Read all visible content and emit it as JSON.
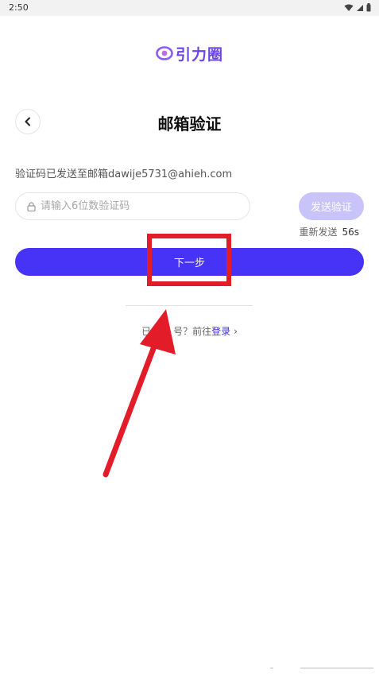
{
  "status_bar": {
    "time": "2:50",
    "icons": [
      "wifi-icon",
      "cellular-icon",
      "battery-icon"
    ]
  },
  "brand": {
    "name": "引力圈",
    "logo_icon": "orbit-logo-icon",
    "color": "#6a44e8"
  },
  "header": {
    "back_icon": "chevron-left-icon",
    "title": "邮箱验证"
  },
  "hint": {
    "text": "验证码已发送至邮箱dawije5731@ahieh.com"
  },
  "code_input": {
    "placeholder": "请输入6位数验证码",
    "value": "",
    "icon": "lock-icon"
  },
  "send_code": {
    "label": "发送验证",
    "color": "#c8c3f8"
  },
  "resend": {
    "label": "重新发送",
    "seconds": "56s"
  },
  "next": {
    "label": "下一步",
    "color": "#4633f5"
  },
  "login_prompt": {
    "prefix": "已",
    "middle": "号？前往",
    "link": "登录",
    "link_color": "#3a2fd9"
  },
  "annotation": {
    "color": "#e31c2a"
  }
}
